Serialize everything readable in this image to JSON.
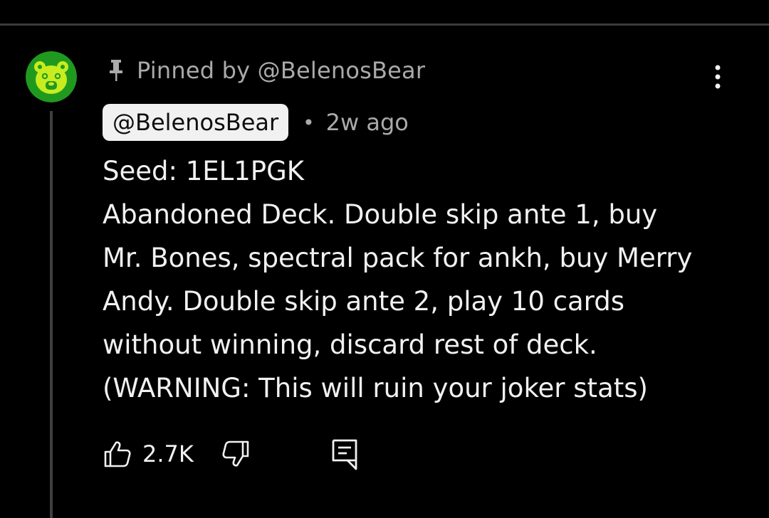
{
  "colors": {
    "background": "#000000",
    "avatar_bg": "#1f9a1f",
    "avatar_face": "#c7ec1f",
    "divider": "#3a3a3a",
    "muted_text": "#aaaaaa",
    "chip_bg": "#f1f1f1"
  },
  "comment": {
    "pinned_label": "Pinned by @BelenosBear",
    "author": "@BelenosBear",
    "separator": "•",
    "time_ago": "2w ago",
    "body_lines": [
      "Seed: 1EL1PGK",
      "Abandoned Deck. Double skip ante 1, buy",
      "Mr. Bones, spectral pack for ankh, buy Merry",
      "Andy. Double skip ante 2, play 10 cards",
      "without winning, discard rest of deck.",
      "(WARNING: This will ruin your joker stats)"
    ],
    "like_count": "2.7K"
  },
  "icons": {
    "avatar": "bear-avatar-icon",
    "pin": "pin-icon",
    "more": "more-vertical-icon",
    "like": "thumbs-up-icon",
    "dislike": "thumbs-down-icon",
    "reply": "reply-comment-icon"
  }
}
